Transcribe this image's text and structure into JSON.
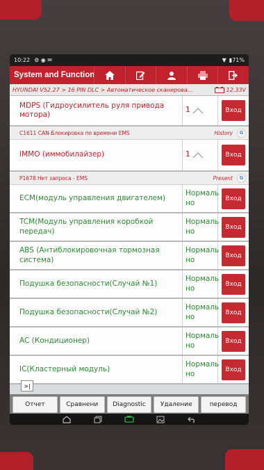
{
  "statusbar": {
    "time": "10:22",
    "battery": "71"
  },
  "app": {
    "title": "System and Function"
  },
  "toolbar_icons": [
    "home-icon",
    "report-icon",
    "user-icon",
    "print-icon",
    "exit-icon"
  ],
  "path": {
    "text": "HYUNDAI V52.27 > 16 PIN DLC > Автоматическое сканирова...",
    "voltage": "12.33V"
  },
  "systems": [
    {
      "name": "MDPS (Гидроусилитель руля привода мотора)",
      "status": "1",
      "enter": "Вход",
      "fault": true,
      "dtc": {
        "code": "C1611 CAN-Блокировка по времени EMS",
        "tag": "History"
      }
    },
    {
      "name": "IMMO (иммобилайзер)",
      "status": "1",
      "enter": "Вход",
      "fault": true,
      "dtc": {
        "code": "P1678 Нет запроса - EMS",
        "tag": "Present"
      }
    },
    {
      "name": "ECM(модуль управления двигателем)",
      "status": "Нормаль но",
      "enter": "Вход",
      "fault": false
    },
    {
      "name": "TCM(Модуль управления коробкой передач)",
      "status": "Нормаль но",
      "enter": "Вход",
      "fault": false
    },
    {
      "name": "ABS (Антиблокировочная тормозная система)",
      "status": "Нормаль но",
      "enter": "Вход",
      "fault": false
    },
    {
      "name": "Подушка безопасности(Случай №1)",
      "status": "Нормаль но",
      "enter": "Вход",
      "fault": false
    },
    {
      "name": "Подушка безопасности(Случай №2)",
      "status": "Нормаль но",
      "enter": "Вход",
      "fault": false
    },
    {
      "name": "AC (Кондиционер)",
      "status": "Нормаль но",
      "enter": "Вход",
      "fault": false
    },
    {
      "name": "IC(Кластерный модуль)",
      "status": "Нормаль но",
      "enter": "Вход",
      "fault": false
    }
  ],
  "expand_label": ">|",
  "bottom_buttons": [
    "Отчет",
    "Сравнени",
    "Diagnostic",
    "Удаление",
    "перевод"
  ],
  "colors": {
    "brand_red": "#c0222d",
    "ok_green": "#2d8a34",
    "button_red": "#c42a2f"
  }
}
